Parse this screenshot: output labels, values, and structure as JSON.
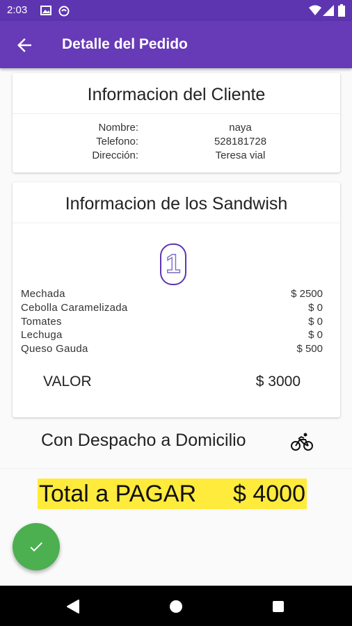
{
  "status_bar": {
    "time": "2:03",
    "icons": [
      "gallery-icon",
      "circle-status-icon",
      "wifi-icon",
      "signal-icon",
      "battery-icon"
    ]
  },
  "app_bar": {
    "title": "Detalle del Pedido",
    "back_icon": "arrow-back-icon",
    "background": "#673ab7"
  },
  "client_card": {
    "title": "Informacion del Cliente",
    "rows": [
      {
        "label": "Nombre:",
        "value": "naya"
      },
      {
        "label": "Telefono:",
        "value": "528181728"
      },
      {
        "label": "Dirección:",
        "value": "Teresa vial"
      }
    ]
  },
  "sandwich_card": {
    "title": "Informacion de los Sandwish",
    "quantity": "1",
    "ingredients": [
      {
        "name": "Mechada",
        "price": "$ 2500"
      },
      {
        "name": "Cebolla Caramelizada",
        "price": "$ 0"
      },
      {
        "name": "Tomates",
        "price": "$ 0"
      },
      {
        "name": "Lechuga",
        "price": "$ 0"
      },
      {
        "name": "Queso Gauda",
        "price": "$ 500"
      }
    ],
    "valor_label": "VALOR",
    "valor_amount": "$ 3000"
  },
  "delivery": {
    "text": "Con Despacho a Domicilio",
    "icon": "bike-icon"
  },
  "total": {
    "label": "Total a PAGAR",
    "amount": "$ 4000",
    "highlight_color": "#ffeb3b"
  },
  "fab": {
    "icon": "check-icon",
    "color": "#4caf50"
  },
  "nav_bar": {
    "buttons": [
      "back-triangle-icon",
      "home-circle-icon",
      "recents-square-icon"
    ]
  }
}
